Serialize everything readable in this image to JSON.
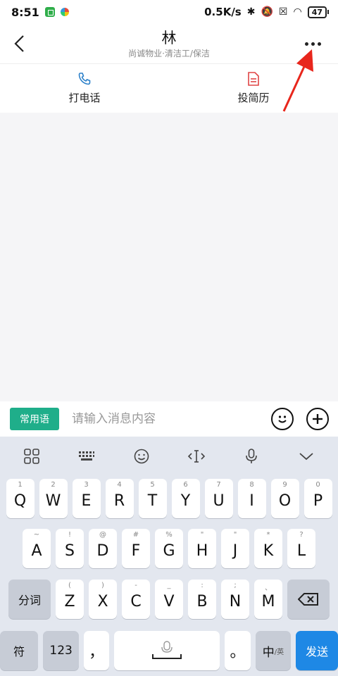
{
  "status_bar": {
    "time": "8:51",
    "network_speed": "0.5K/s",
    "battery": "47"
  },
  "header": {
    "title": "林",
    "subtitle": "尚诚物业·清洁工/保洁"
  },
  "actions": [
    {
      "label": "打电话",
      "icon": "phone-icon"
    },
    {
      "label": "投简历",
      "icon": "resume-icon"
    }
  ],
  "input_bar": {
    "phrase_label": "常用语",
    "placeholder": "请输入消息内容"
  },
  "keyboard": {
    "row1": [
      {
        "hint": "1",
        "key": "Q"
      },
      {
        "hint": "2",
        "key": "W"
      },
      {
        "hint": "3",
        "key": "E"
      },
      {
        "hint": "4",
        "key": "R"
      },
      {
        "hint": "5",
        "key": "T"
      },
      {
        "hint": "6",
        "key": "Y"
      },
      {
        "hint": "7",
        "key": "U"
      },
      {
        "hint": "8",
        "key": "I"
      },
      {
        "hint": "9",
        "key": "O"
      },
      {
        "hint": "0",
        "key": "P"
      }
    ],
    "row2": [
      {
        "hint": "~",
        "key": "A"
      },
      {
        "hint": "!",
        "key": "S"
      },
      {
        "hint": "@",
        "key": "D"
      },
      {
        "hint": "#",
        "key": "F"
      },
      {
        "hint": "%",
        "key": "G"
      },
      {
        "hint": "\"",
        "key": "H"
      },
      {
        "hint": "\"",
        "key": "J"
      },
      {
        "hint": "*",
        "key": "K"
      },
      {
        "hint": "?",
        "key": "L"
      }
    ],
    "row3_left": "分词",
    "row3": [
      {
        "hint": "(",
        "key": "Z"
      },
      {
        "hint": ")",
        "key": "X"
      },
      {
        "hint": "-",
        "key": "C"
      },
      {
        "hint": "_",
        "key": "V"
      },
      {
        "hint": ":",
        "key": "B"
      },
      {
        "hint": ";",
        "key": "N"
      },
      {
        "hint": "、",
        "key": "M"
      }
    ],
    "symbol_label": "符",
    "number_label": "123",
    "comma": "，",
    "period": "。",
    "lang_main": "中",
    "lang_sub": "/英",
    "send_label": "发送"
  }
}
